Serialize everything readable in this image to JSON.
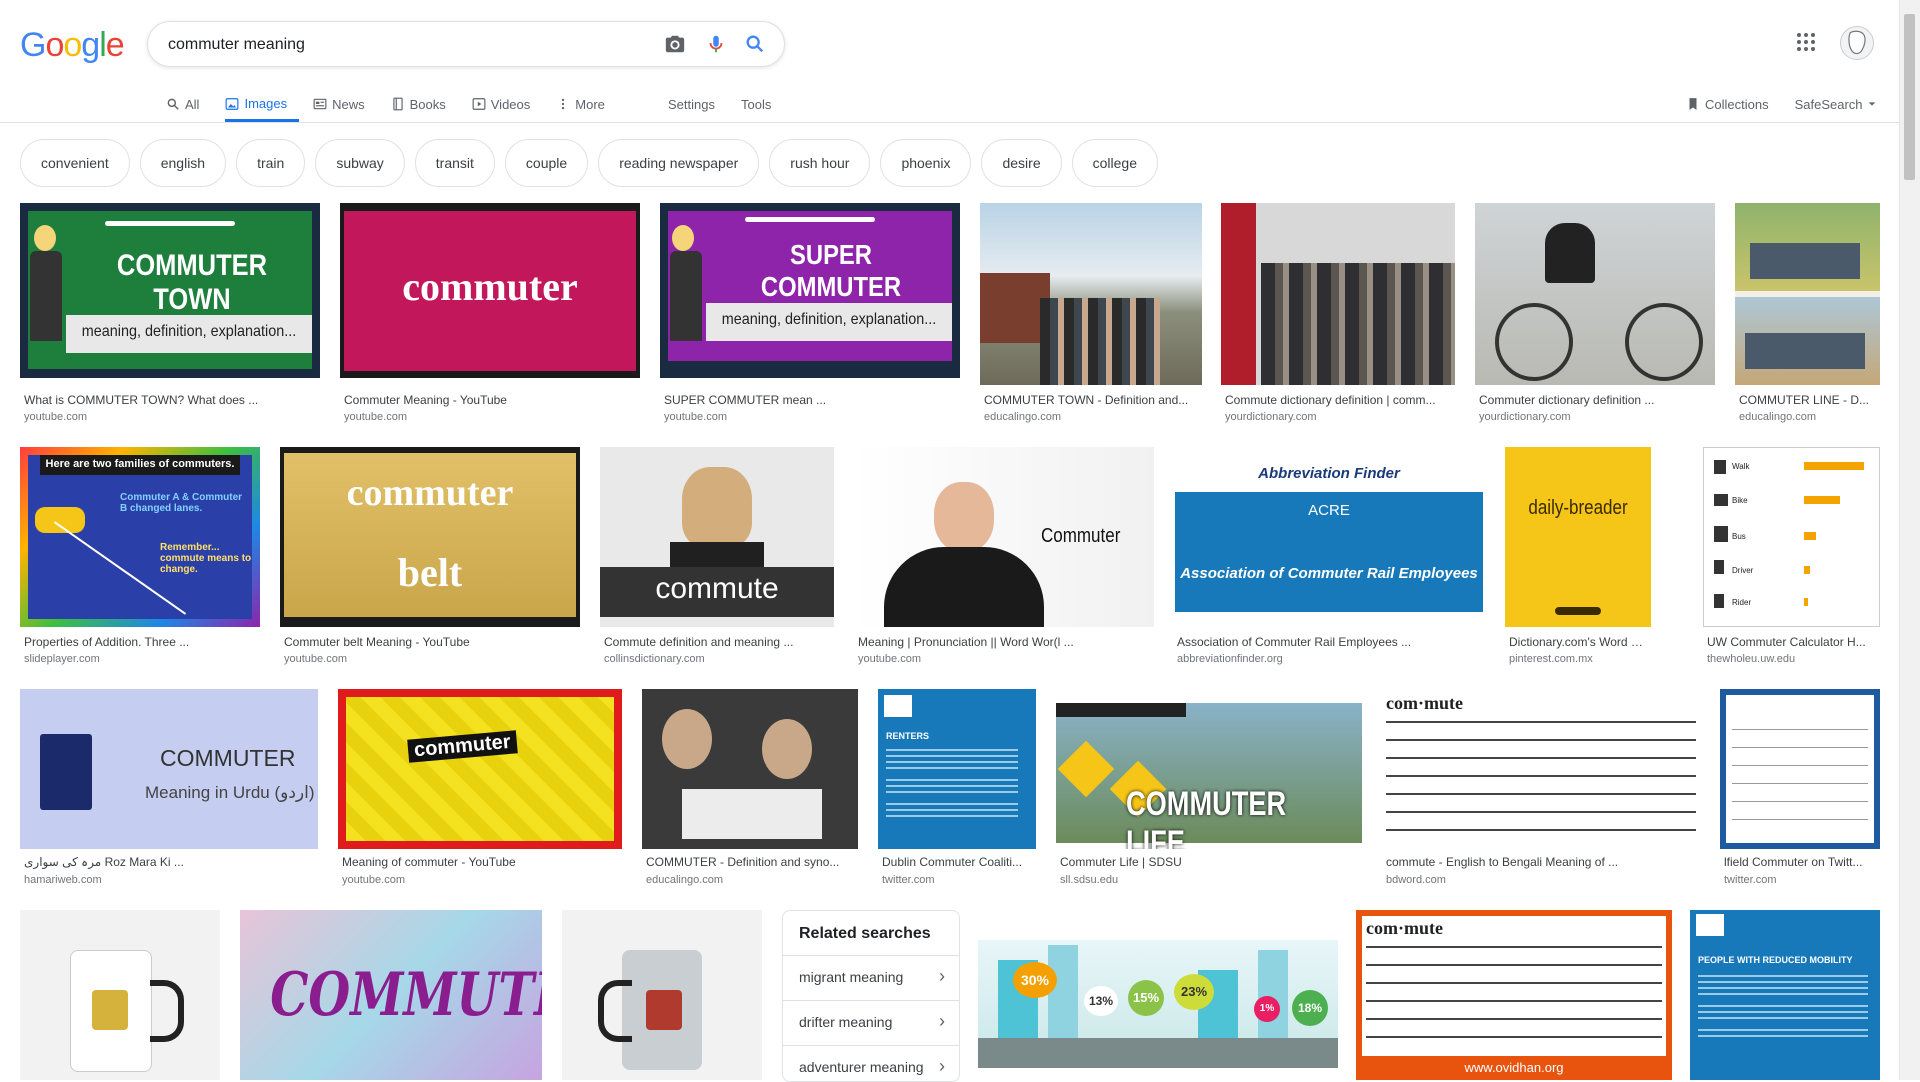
{
  "logo": {
    "letters": [
      "G",
      "o",
      "o",
      "g",
      "l",
      "e"
    ],
    "colors": [
      "#4285F4",
      "#EA4335",
      "#FBBC05",
      "#4285F4",
      "#34A853",
      "#EA4335"
    ]
  },
  "search": {
    "value": "commuter meaning"
  },
  "tabs": [
    {
      "label": "All",
      "icon": "search-icon"
    },
    {
      "label": "Images",
      "icon": "image-icon",
      "active": true
    },
    {
      "label": "News",
      "icon": "news-icon"
    },
    {
      "label": "Books",
      "icon": "book-icon"
    },
    {
      "label": "Videos",
      "icon": "video-icon"
    },
    {
      "label": "More",
      "icon": "more-vert-icon"
    }
  ],
  "settings_label": "Settings",
  "tools_label": "Tools",
  "collections_label": "Collections",
  "safesearch_label": "SafeSearch",
  "chips": [
    "convenient",
    "english",
    "train",
    "subway",
    "transit",
    "couple",
    "reading newspaper",
    "rush hour",
    "phoenix",
    "desire",
    "college"
  ],
  "results": [
    {
      "caption": "What is COMMUTER TOWN? What does ...",
      "source": "youtube.com",
      "overlay": "COMMUTER TOWN",
      "sub": "meaning, definition, explanation..."
    },
    {
      "caption": "Commuter Meaning - YouTube",
      "source": "youtube.com",
      "overlay": "commuter"
    },
    {
      "caption": "SUPER COMMUTER mean ...",
      "source": "youtube.com",
      "overlay": "SUPER COMMUTER",
      "sub": "meaning, definition, explanation..."
    },
    {
      "caption": "COMMUTER TOWN - Definition and...",
      "source": "educalingo.com"
    },
    {
      "caption": "Commute dictionary definition | comm...",
      "source": "yourdictionary.com"
    },
    {
      "caption": "Commuter dictionary definition ...",
      "source": "yourdictionary.com"
    },
    {
      "caption": "COMMUTER LINE - D...",
      "source": "educalingo.com"
    },
    {
      "caption": "Properties of Addition. Three ...",
      "source": "slideplayer.com",
      "overlay": "Here are two families of commuters.",
      "sub": "Commuter A & Commuter B changed lanes.",
      "sub2": "Remember... commute means to change."
    },
    {
      "caption": "Commuter belt Meaning - YouTube",
      "source": "youtube.com",
      "overlay": "commuter",
      "sub": "belt"
    },
    {
      "caption": "Commute definition and meaning ...",
      "source": "collinsdictionary.com",
      "overlay": "commute"
    },
    {
      "caption": "Meaning | Pronunciation || Word Wor(l ...",
      "source": "youtube.com",
      "overlay": "Commuter"
    },
    {
      "caption": "Association of Commuter Rail Employees ...",
      "source": "abbreviationfinder.org",
      "overlay": "Abbreviation Finder",
      "sub": "ACRE",
      "sub2": "Association of Commuter Rail Employees"
    },
    {
      "caption": "Dictionary.com's Word of the...",
      "source": "pinterest.com.mx",
      "overlay": "daily-breader"
    },
    {
      "caption": "UW Commuter Calculator H...",
      "source": "thewholeu.uw.edu",
      "rows": [
        "Walk",
        "Bike",
        "Bus",
        "Driver",
        "Rider"
      ]
    },
    {
      "caption": "مرہ کی سواری Roz Mara Ki ...",
      "source": "hamariweb.com",
      "overlay": "COMMUTER",
      "sub": "Meaning in Urdu (اردو)"
    },
    {
      "caption": "Meaning of commuter - YouTube",
      "source": "youtube.com",
      "overlay": "commuter"
    },
    {
      "caption": "COMMUTER - Definition and syno...",
      "source": "educalingo.com"
    },
    {
      "caption": "Dublin Commuter Coaliti...",
      "source": "twitter.com",
      "overlay": "RENTERS"
    },
    {
      "caption": "Commuter Life | SDSU",
      "source": "sll.sdsu.edu",
      "overlay": "COMMUTER LIFE"
    },
    {
      "caption": "commute - English to Bengali Meaning of ...",
      "source": "bdword.com",
      "overlay": "com·mute"
    },
    {
      "caption": "lfield Commuter on Twitt...",
      "source": "twitter.com"
    }
  ],
  "bottom_overlays": {
    "commuter_script": "COMMUTER",
    "bengali": "com·mute",
    "bengali_site": "www.ovidhan.org",
    "mobility": "PEOPLE WITH REDUCED MOBILITY",
    "city_pcts": [
      "30%",
      "13%",
      "15%",
      "23%",
      "1%",
      "18%"
    ]
  },
  "related": {
    "title": "Related searches",
    "items": [
      "migrant meaning",
      "drifter meaning",
      "adventurer meaning"
    ]
  },
  "colors": {
    "accent": "#1a73e8"
  }
}
